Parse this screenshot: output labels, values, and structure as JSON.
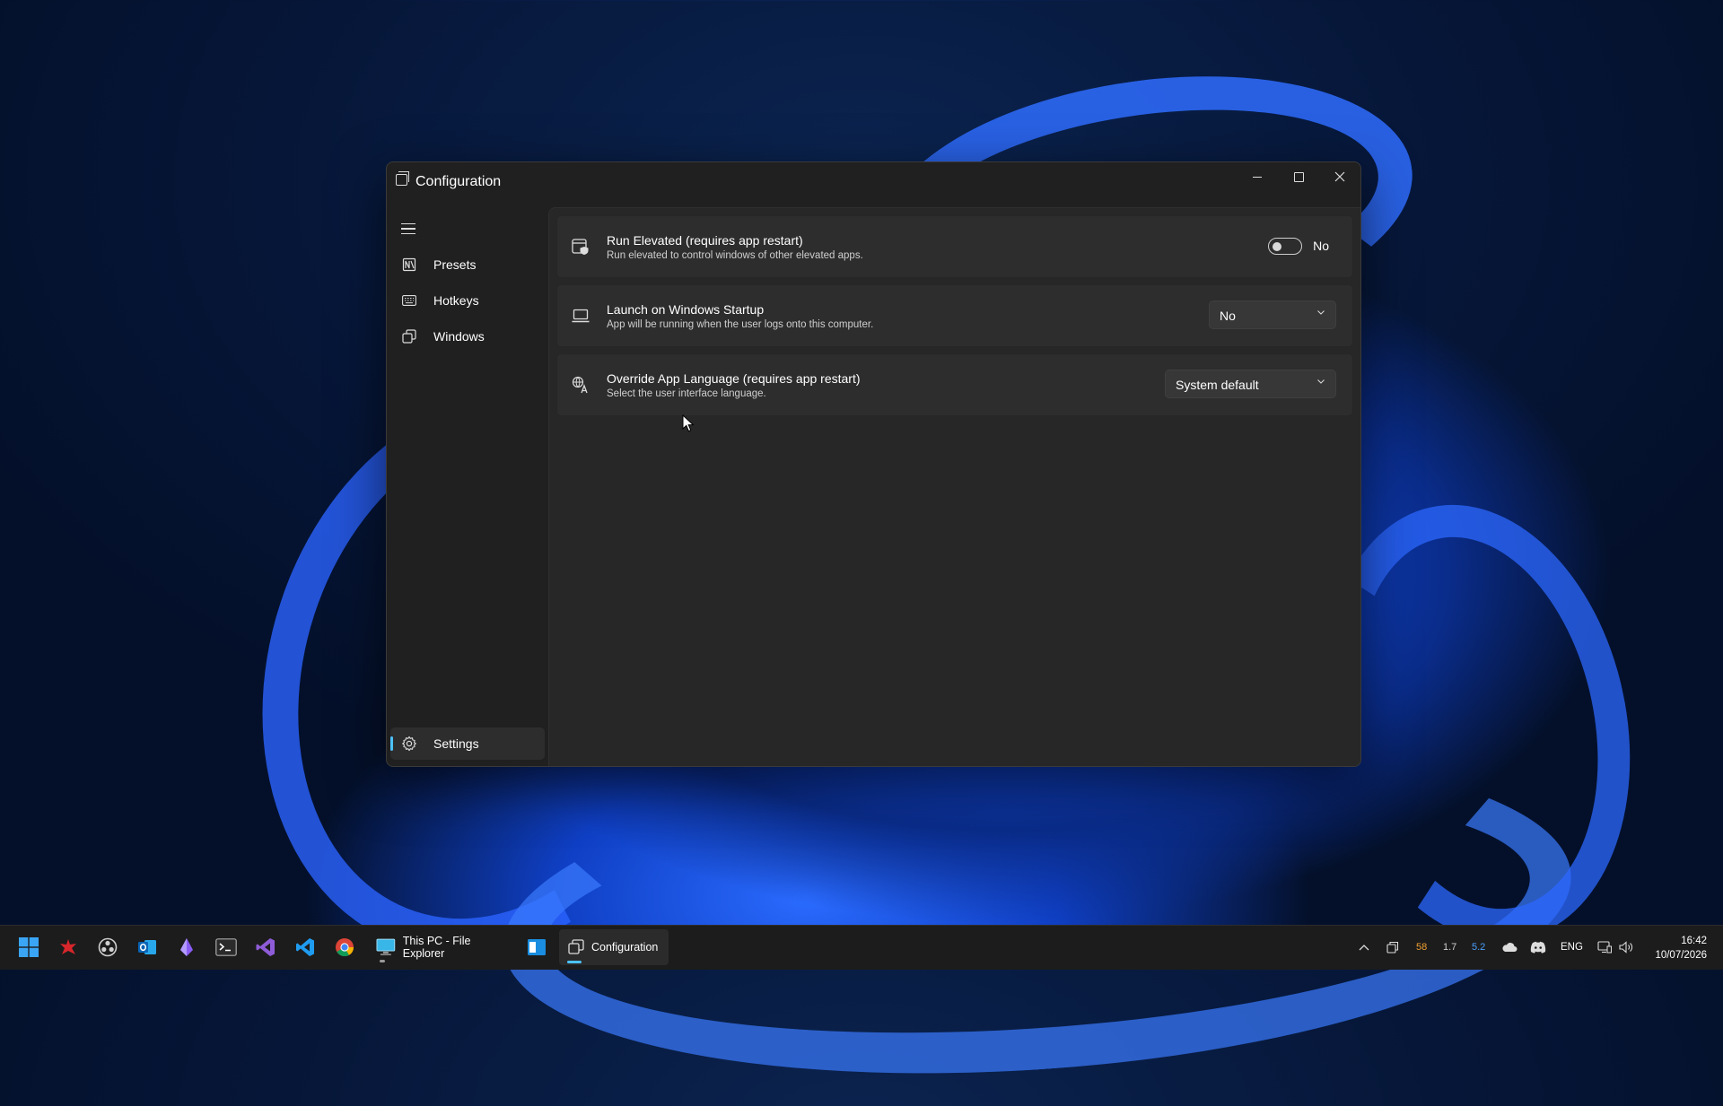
{
  "window": {
    "title": "Configuration",
    "caption": {
      "minimize": "minimize",
      "maximize": "maximize",
      "close": "close"
    }
  },
  "sidebar": {
    "items": [
      {
        "label": "Presets",
        "icon": "presets-icon"
      },
      {
        "label": "Hotkeys",
        "icon": "keyboard-icon"
      },
      {
        "label": "Windows",
        "icon": "windows-stack-icon"
      }
    ],
    "footer": {
      "label": "Settings",
      "icon": "gear-icon",
      "selected": true
    }
  },
  "settings": [
    {
      "title": "Run Elevated (requires app restart)",
      "subtitle": "Run elevated to control windows of other elevated apps.",
      "control": "toggle",
      "value": "No",
      "checked": false,
      "icon": "shield-window-icon"
    },
    {
      "title": "Launch on Windows Startup",
      "subtitle": "App will be running when the user logs onto this computer.",
      "control": "combo",
      "value": "No",
      "icon": "laptop-icon"
    },
    {
      "title": "Override App Language (requires app restart)",
      "subtitle": "Select the user interface language.",
      "control": "combo",
      "value": "System default",
      "icon": "language-icon"
    }
  ],
  "taskbar": {
    "apps": [
      {
        "name": "start-button"
      },
      {
        "name": "app-red-icon"
      },
      {
        "name": "obs-icon"
      },
      {
        "name": "outlook-icon"
      },
      {
        "name": "app-purple-icon"
      },
      {
        "name": "terminal-icon"
      },
      {
        "name": "visual-studio-icon"
      },
      {
        "name": "vscode-icon"
      },
      {
        "name": "chrome-icon"
      }
    ],
    "file_explorer_label": "This PC - File Explorer",
    "configuration_label": "Configuration",
    "tray": {
      "stat1": "58",
      "stat2": "1.7",
      "stat3": "5.2",
      "language": "ENG",
      "time": "16:42",
      "date": "10/07/2026"
    },
    "colors": {
      "stat1": "#f0a030",
      "stat3": "#4aa0ff",
      "accent": "#4cc2ff"
    }
  }
}
